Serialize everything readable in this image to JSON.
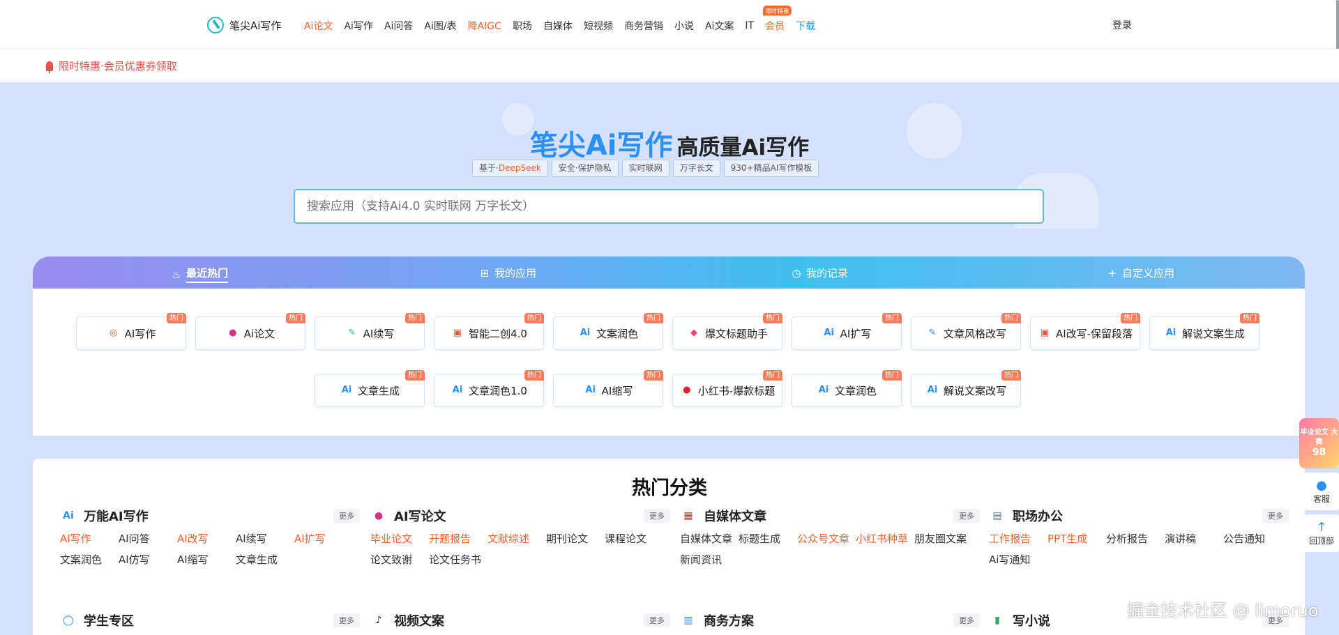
{
  "header": {
    "logo_text": "笔尖Ai写作",
    "nav": [
      {
        "label": "Ai论文",
        "color": "#f2642e"
      },
      {
        "label": "Ai写作"
      },
      {
        "label": "Ai问答"
      },
      {
        "label": "Ai图/表"
      },
      {
        "label": "降AIGC",
        "color": "#f2642e"
      },
      {
        "label": "职场"
      },
      {
        "label": "自媒体"
      },
      {
        "label": "短视频"
      },
      {
        "label": "商务营销"
      },
      {
        "label": "小说"
      },
      {
        "label": "Ai文案"
      },
      {
        "label": "IT"
      },
      {
        "label": "会员",
        "color": "#f2642e",
        "badge": "限时特惠"
      },
      {
        "label": "下载",
        "color": "#1e9be8"
      }
    ],
    "login_label": "登录"
  },
  "promo_bar": {
    "text": "限时特惠·会员优惠券领取"
  },
  "hero": {
    "brand": "笔尖Ai写作",
    "subtitle": "高质量Ai写作",
    "chips": [
      {
        "prefix": "基于·",
        "highlight": "DeepSeek"
      },
      {
        "text": "安全·保护隐私"
      },
      {
        "text": "实时联网"
      },
      {
        "text": "万字长文"
      },
      {
        "text": "930+精品AI写作模板"
      }
    ],
    "search_placeholder": "搜索应用（支持Ai4.0 实时联网 万字长文）"
  },
  "tabs": [
    {
      "label": "最近热门",
      "icon": "fire-icon",
      "active": true
    },
    {
      "label": "我的应用",
      "icon": "grid-icon"
    },
    {
      "label": "我的记录",
      "icon": "clock-icon"
    },
    {
      "label": "自定义应用",
      "icon": "plus-icon"
    }
  ],
  "hot_badge": "热门",
  "apps": [
    {
      "label": "AI写作",
      "icon": "pen-circle-icon",
      "color": "#e25a3d"
    },
    {
      "label": "Ai论文",
      "icon": "paper-circle-icon",
      "color": "#d63384"
    },
    {
      "label": "AI续写",
      "icon": "brush-icon",
      "color": "#2bb5c5"
    },
    {
      "label": "智能二创4.0",
      "icon": "rewrite-icon",
      "color": "#e25a3d"
    },
    {
      "label": "文案润色",
      "icon": "ai-plus-icon",
      "color": "#2b8ff3"
    },
    {
      "label": "爆文标题助手",
      "icon": "tag-icon",
      "color": "#e8466d"
    },
    {
      "label": "AI扩写",
      "icon": "ai-plus-icon",
      "color": "#2b8ff3"
    },
    {
      "label": "文章风格改写",
      "icon": "edit-icon",
      "color": "#2b8ff3"
    },
    {
      "label": "AI改写-保留段落",
      "icon": "rewrite-icon",
      "color": "#e25a3d"
    },
    {
      "label": "解说文案生成",
      "icon": "ai-plus-icon",
      "color": "#2b8ff3"
    },
    {
      "label": "文章生成",
      "icon": "ai-plus-icon",
      "color": "#2b8ff3"
    },
    {
      "label": "文章润色1.0",
      "icon": "ai-plus-icon",
      "color": "#2b8ff3"
    },
    {
      "label": "AI缩写",
      "icon": "ai-plus-icon",
      "color": "#2b8ff3"
    },
    {
      "label": "小红书-爆款标题",
      "icon": "xiaohongshu-icon",
      "color": "#e02030"
    },
    {
      "label": "文章润色",
      "icon": "ai-plus-icon",
      "color": "#2b8ff3"
    },
    {
      "label": "解说文案改写",
      "icon": "ai-plus-icon",
      "color": "#2b8ff3"
    }
  ],
  "categories": {
    "title": "热门分类",
    "more_label": "更多",
    "groups": [
      {
        "name": "万能AI写作",
        "icon": "ai-plus-icon",
        "links": [
          {
            "label": "AI写作",
            "orange": true
          },
          {
            "label": "AI问答"
          },
          {
            "label": "AI改写",
            "orange": true
          },
          {
            "label": "AI续写"
          },
          {
            "label": "AI扩写",
            "orange": true
          },
          {
            "label": "文案润色"
          },
          {
            "label": "AI仿写"
          },
          {
            "label": "AI缩写"
          },
          {
            "label": "文章生成"
          }
        ]
      },
      {
        "name": "AI写论文",
        "icon": "paper-circle-icon",
        "links": [
          {
            "label": "毕业论文",
            "orange": true
          },
          {
            "label": "开题报告",
            "orange": true
          },
          {
            "label": "文献综述",
            "orange": true
          },
          {
            "label": "期刊论文"
          },
          {
            "label": "课程论文"
          },
          {
            "label": "论文致谢"
          },
          {
            "label": "论文任务书"
          }
        ]
      },
      {
        "name": "自媒体文章",
        "icon": "media-logos-icon",
        "links": [
          {
            "label": "自媒体文章"
          },
          {
            "label": "标题生成"
          },
          {
            "label": "公众号文章",
            "orange": true
          },
          {
            "label": "小红书种草",
            "orange": true
          },
          {
            "label": "朋友圈文案"
          },
          {
            "label": "新闻资讯"
          }
        ]
      },
      {
        "name": "职场办公",
        "icon": "briefcase-icon",
        "links": [
          {
            "label": "工作报告",
            "orange": true
          },
          {
            "label": "PPT生成",
            "orange": true
          },
          {
            "label": "分析报告"
          },
          {
            "label": "演讲稿"
          },
          {
            "label": "公告通知"
          },
          {
            "label": "Ai写通知"
          }
        ]
      },
      {
        "name": "学生专区",
        "icon": "student-icon",
        "links": []
      },
      {
        "name": "视频文案",
        "icon": "tiktok-icon",
        "links": []
      },
      {
        "name": "商务方案",
        "icon": "business-icon",
        "links": []
      },
      {
        "name": "写小说",
        "icon": "book-icon",
        "links": []
      }
    ]
  },
  "side": {
    "promo_text": "毕业论文 大赛",
    "promo_number": "98",
    "support_label": "客服",
    "top_label": "回顶部"
  },
  "watermark": "掘金技术社区 @ limoruo"
}
